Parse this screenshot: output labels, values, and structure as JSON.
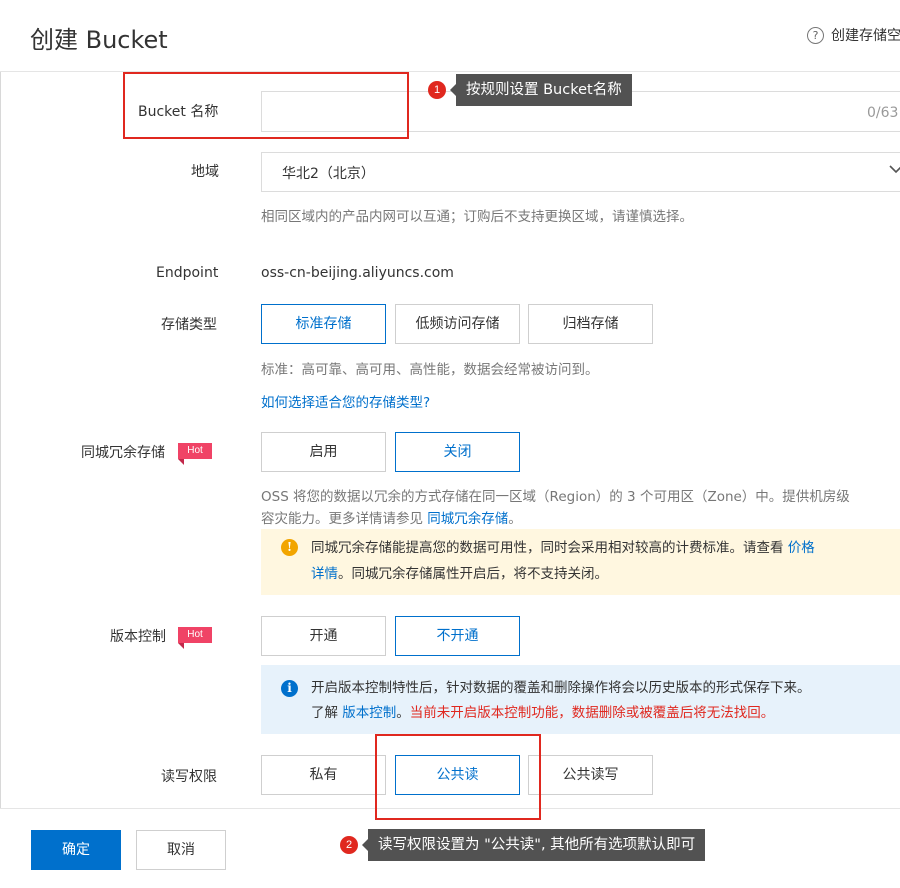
{
  "header": {
    "title": "创建 Bucket",
    "help_icon": "?",
    "help_label": "创建存储空"
  },
  "form": {
    "bucket_name": {
      "label": "Bucket 名称",
      "value": "",
      "counter": "0/63"
    },
    "region": {
      "label": "地域",
      "selected": "华北2（北京）",
      "help": "相同区域内的产品内网可以互通；订购后不支持更换区域，请谨慎选择。"
    },
    "endpoint": {
      "label": "Endpoint",
      "value": "oss-cn-beijing.aliyuncs.com"
    },
    "storage_class": {
      "label": "存储类型",
      "options": [
        "标准存储",
        "低频访问存储",
        "归档存储"
      ],
      "selected": "标准存储",
      "help": "标准：高可靠、高可用、高性能，数据会经常被访问到。",
      "link": "如何选择适合您的存储类型?"
    },
    "redundancy": {
      "label": "同城冗余存储",
      "tag": "Hot",
      "options": [
        "启用",
        "关闭"
      ],
      "selected": "关闭",
      "help_line1": "OSS 将您的数据以冗余的方式存储在同一区域（Region）的 3 个可用区（Zone）中。提供机房级",
      "help_line2_prefix": "容灾能力。更多详情请参见 ",
      "help_line2_link": "同城冗余存储",
      "help_line2_suffix": "。",
      "notice_icon": "!",
      "notice_line1_text": "同城冗余存储能提高您的数据可用性，同时会采用相对较高的计费标准。请查看 ",
      "notice_line1_link": "价格",
      "notice_line2_link": "详情",
      "notice_line2_text": "。同城冗余存储属性开启后，将不支持关闭。"
    },
    "versioning": {
      "label": "版本控制",
      "tag": "Hot",
      "options": [
        "开通",
        "不开通"
      ],
      "selected": "不开通",
      "notice_icon": "i",
      "notice_line1": "开启版本控制特性后，针对数据的覆盖和删除操作将会以历史版本的形式保存下来。",
      "notice_line2_prefix": "了解 ",
      "notice_line2_link": "版本控制",
      "notice_line2_sep": "。",
      "notice_line2_warning": "当前未开启版本控制功能，数据删除或被覆盖后将无法找回。"
    },
    "acl": {
      "label": "读写权限",
      "options": [
        "私有",
        "公共读",
        "公共读写"
      ],
      "selected": "公共读"
    }
  },
  "footer": {
    "confirm_label": "确定",
    "cancel_label": "取消"
  },
  "annotations": {
    "step1_number": "1",
    "step1_text": "按规则设置 Bucket名称",
    "step2_number": "2",
    "step2_text": "读写权限设置为 \"公共读\", 其他所有选项默认即可"
  },
  "colors": {
    "primary": "#0070cc",
    "annotation_red": "#e0281f",
    "hot_tag": "#f04366",
    "warning_bg": "#fff7e0",
    "info_bg": "#e7f2fb"
  }
}
